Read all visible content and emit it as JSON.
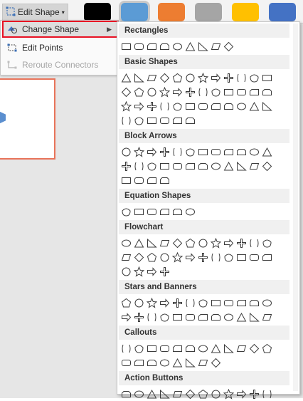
{
  "ribbon": {
    "edit_shape_label": "Edit Shape",
    "swatch_colors": [
      "#000000",
      "#5b9bd5",
      "#ed7d31",
      "#a5a5a5",
      "#ffc000",
      "#4472c4"
    ]
  },
  "menu": {
    "items": [
      {
        "label": "Change Shape",
        "icon": "change-shape-icon"
      },
      {
        "label": "Edit Points",
        "icon": "edit-points-icon"
      },
      {
        "label": "Reroute Connectors",
        "icon": "reroute-connectors-icon"
      }
    ]
  },
  "gallery": {
    "categories": [
      {
        "name": "Rectangles",
        "rows": [
          9
        ]
      },
      {
        "name": "Basic Shapes",
        "rows": [
          12,
          12,
          12,
          6
        ]
      },
      {
        "name": "Block Arrows",
        "rows": [
          12,
          12,
          4
        ]
      },
      {
        "name": "Equation Shapes",
        "rows": [
          6
        ]
      },
      {
        "name": "Flowchart",
        "rows": [
          12,
          12,
          4
        ]
      },
      {
        "name": "Stars and Banners",
        "rows": [
          12,
          12
        ]
      },
      {
        "name": "Callouts",
        "rows": [
          12,
          8
        ]
      },
      {
        "name": "Action Buttons",
        "rows": [
          12
        ]
      }
    ]
  },
  "colors": {
    "accent_red": "#e81123",
    "shape_stroke": "#3c3c3c",
    "slide_border": "#e8735a"
  }
}
